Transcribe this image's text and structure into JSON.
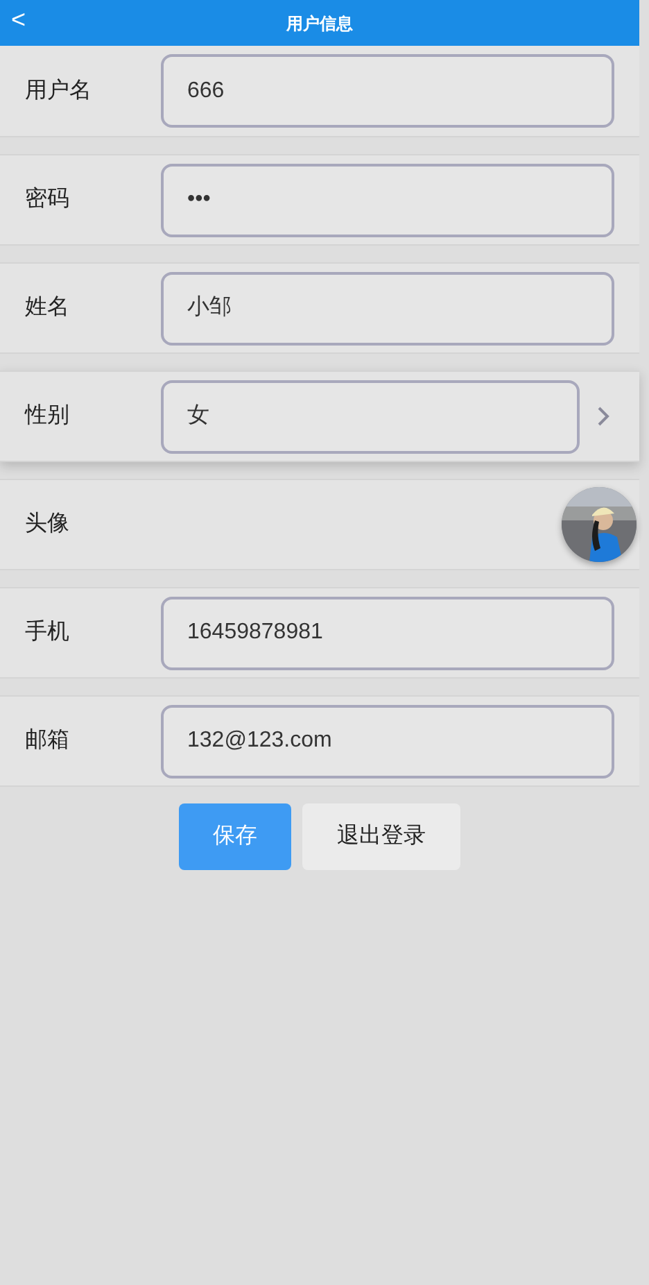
{
  "header": {
    "back": "<",
    "title": "用户信息"
  },
  "rows": [
    {
      "kind": "input",
      "label": "用户名",
      "value": "666"
    },
    {
      "kind": "input",
      "label": "密码",
      "value": "•••"
    },
    {
      "kind": "input",
      "label": "姓名",
      "value": "小邹"
    },
    {
      "kind": "select",
      "label": "性别",
      "value": "女"
    },
    {
      "kind": "avatar",
      "label": "头像"
    },
    {
      "kind": "input",
      "label": "手机",
      "value": "16459878981"
    },
    {
      "kind": "input",
      "label": "邮箱",
      "value": "132@123.com"
    }
  ],
  "buttons": [
    {
      "kind": "primary",
      "label": "保存"
    },
    {
      "kind": "secondary",
      "label": "退出登录"
    }
  ]
}
